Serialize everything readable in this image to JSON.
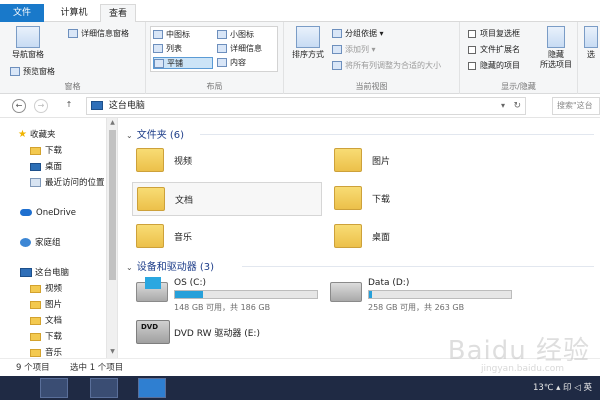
{
  "tabs": {
    "file": "文件",
    "computer": "计算机",
    "view": "查看"
  },
  "ribbon": {
    "panes": {
      "nav_pane": "导航窗格",
      "preview_pane": "预览窗格",
      "details_pane": "详细信息窗格",
      "group_label": "窗格"
    },
    "layout": {
      "medium_icons": "中图标",
      "small_icons": "小图标",
      "list": "列表",
      "details": "详细信息",
      "tiles": "平铺",
      "content": "内容",
      "group_label": "布局"
    },
    "current_view": {
      "sort_by": "排序方式",
      "group_by": "分组依据",
      "add_columns": "添加列",
      "fit_columns": "将所有列调整为合适的大小",
      "group_label": "当前视图"
    },
    "show_hide": {
      "item_checkboxes": "项目复选框",
      "file_extensions": "文件扩展名",
      "hidden_items": "隐藏的项目",
      "hide_selected": "隐藏",
      "hide_selected_2": "所选项目",
      "group_label": "显示/隐藏",
      "options": "选"
    }
  },
  "navbar": {
    "back": "←",
    "forward": "→",
    "up": "↑",
    "address": "这台电脑",
    "search_placeholder": "搜索\"这台"
  },
  "sidebar": {
    "favorites": "收藏夹",
    "downloads": "下载",
    "desktop": "桌面",
    "recent": "最近访问的位置",
    "onedrive": "OneDrive",
    "homegroup": "家庭组",
    "this_pc": "这台电脑",
    "pc_videos": "视频",
    "pc_pictures": "图片",
    "pc_documents": "文档",
    "pc_downloads": "下载",
    "pc_music": "音乐"
  },
  "main": {
    "folders_header": "文件夹 (6)",
    "folders": [
      {
        "name": "视频"
      },
      {
        "name": "图片"
      },
      {
        "name": "文档"
      },
      {
        "name": "下载"
      },
      {
        "name": "音乐"
      },
      {
        "name": "桌面"
      }
    ],
    "devices_header": "设备和驱动器 (3)",
    "drives": [
      {
        "name": "OS (C:)",
        "meta": "148 GB 可用，共 186 GB",
        "used_fraction": 0.2
      },
      {
        "name": "Data (D:)",
        "meta": "258 GB 可用，共 263 GB",
        "used_fraction": 0.02
      },
      {
        "name": "DVD RW 驱动器 (E:)",
        "tag": "DVD"
      }
    ]
  },
  "status": {
    "item_count": "9 个项目",
    "selection": "选中 1 个项目"
  },
  "tray": {
    "text": "13℃  ▴ 印 ◁ 英"
  },
  "watermark": {
    "main": "Baidu 经验",
    "sub": "jingyan.baidu.com"
  },
  "colors": {
    "accent": "#1979ca",
    "drive_fill": "#26a0da",
    "section_header": "#1e3e8a"
  }
}
